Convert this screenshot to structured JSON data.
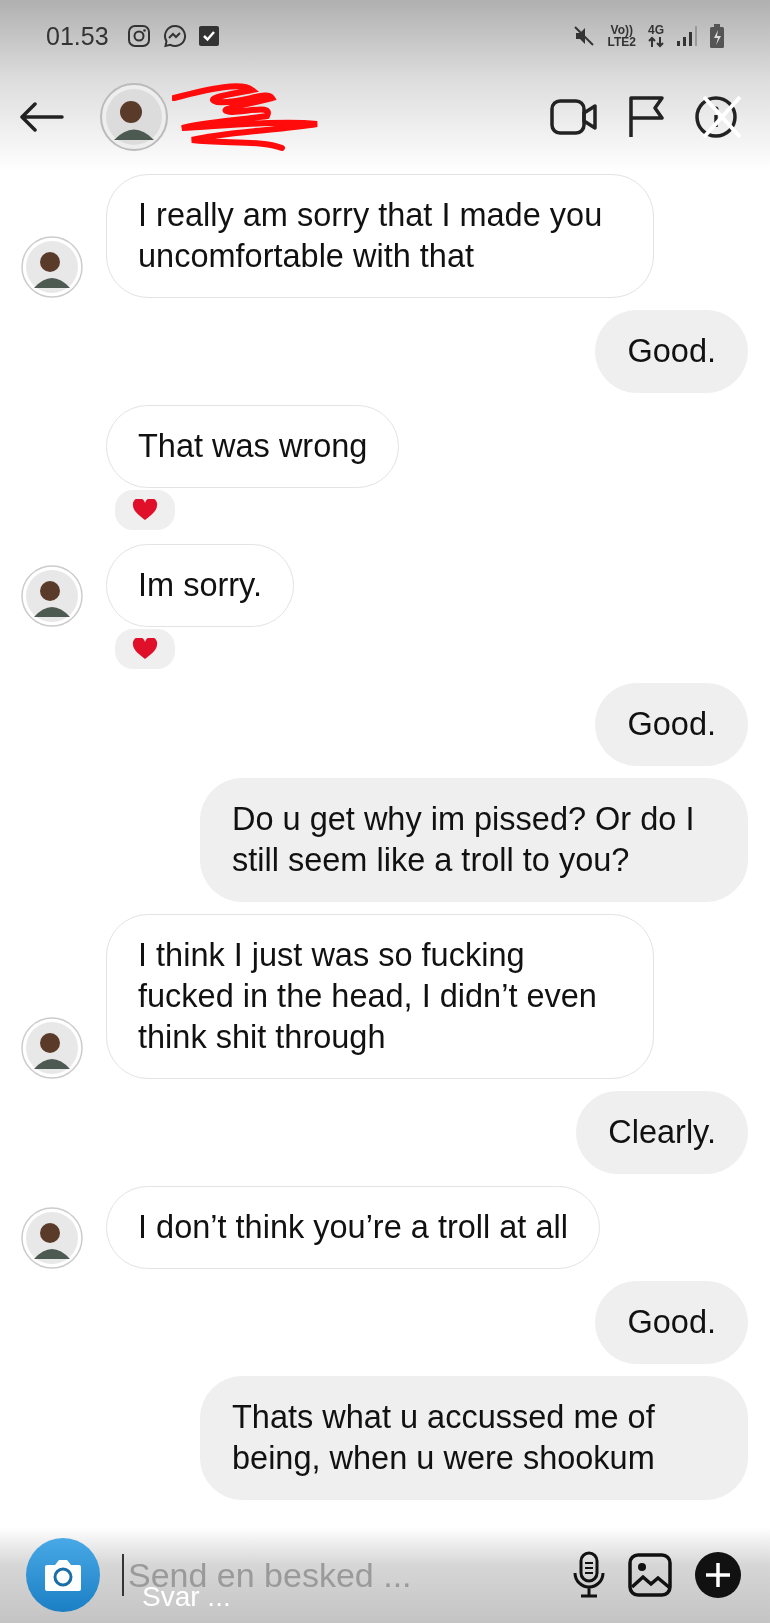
{
  "status_bar": {
    "time": "01.53",
    "network_labels": [
      "Vo))",
      "LTE2",
      "4G"
    ]
  },
  "composer": {
    "placeholder": "Send en besked ...",
    "overlay_text": "Svar ..."
  },
  "messages": [
    {
      "kind": "incoming",
      "text": "I really am sorry that I made you uncomfortable with that",
      "avatar": true,
      "reacted": false
    },
    {
      "kind": "outgoing",
      "text": "Good.",
      "avatar": false,
      "reacted": false
    },
    {
      "kind": "incoming",
      "text": "That was wrong",
      "avatar": false,
      "reacted": true
    },
    {
      "kind": "incoming",
      "text": "Im sorry.",
      "avatar": true,
      "reacted": true
    },
    {
      "kind": "outgoing",
      "text": "Good.",
      "avatar": false,
      "reacted": false
    },
    {
      "kind": "outgoing",
      "text": "Do u get why im pissed? Or do I still seem like a troll to you?",
      "avatar": false,
      "reacted": false
    },
    {
      "kind": "incoming",
      "text": "I think I just was so fucking fucked in the head, I didn’t even think shit through",
      "avatar": true,
      "reacted": false
    },
    {
      "kind": "outgoing",
      "text": "Clearly.",
      "avatar": false,
      "reacted": false
    },
    {
      "kind": "incoming",
      "text": "I don’t think you’re a troll at all",
      "avatar": true,
      "reacted": false
    },
    {
      "kind": "outgoing",
      "text": "Good.",
      "avatar": false,
      "reacted": false
    },
    {
      "kind": "outgoing",
      "text": "Thats what u accussed me of being, when u were shookum",
      "avatar": false,
      "reacted": false
    }
  ]
}
